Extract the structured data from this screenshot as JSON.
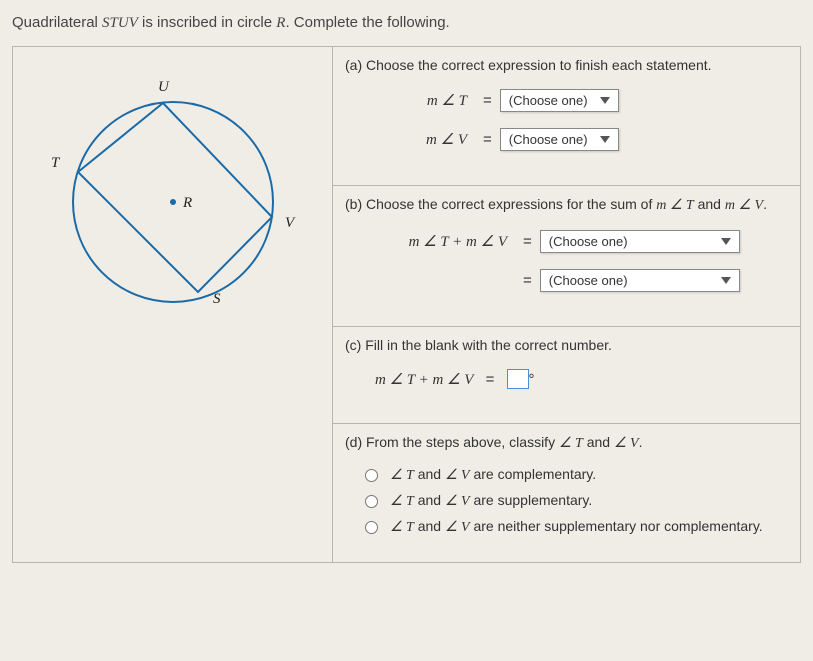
{
  "prompt": {
    "pre": "Quadrilateral ",
    "shape": "STUV",
    "mid": " is inscribed in circle ",
    "circle": "R",
    "post": ". Complete the following."
  },
  "diagram": {
    "labels": {
      "T": "T",
      "U": "U",
      "V": "V",
      "S": "S",
      "R": "R"
    },
    "center_dot": true
  },
  "partA": {
    "head": "(a) Choose the correct expression to finish each statement.",
    "row1_lhs": "m ∠ T",
    "row2_lhs": "m ∠ V",
    "choose": "(Choose one)"
  },
  "partB": {
    "head_pre": "(b) Choose the correct expressions for the sum of ",
    "head_exp1": "m ∠ T",
    "head_mid": " and ",
    "head_exp2": "m ∠ V",
    "head_post": ".",
    "row_lhs": "m ∠ T + m ∠ V",
    "choose": "(Choose one)"
  },
  "partC": {
    "head": "(c) Fill in the blank with the correct number.",
    "row_lhs": "m ∠ T + m ∠ V",
    "unit": "°"
  },
  "partD": {
    "head_pre": "(d) From the steps above, classify ",
    "head_a1": "∠ T",
    "head_mid": " and ",
    "head_a2": "∠ V",
    "head_post": ".",
    "opt1_pre": "∠ T",
    "opt1_mid": " and ",
    "opt1_b": "∠ V",
    "opt1_post": " are complementary.",
    "opt2_post": " are supplementary.",
    "opt3_post": " are neither supplementary nor complementary."
  }
}
